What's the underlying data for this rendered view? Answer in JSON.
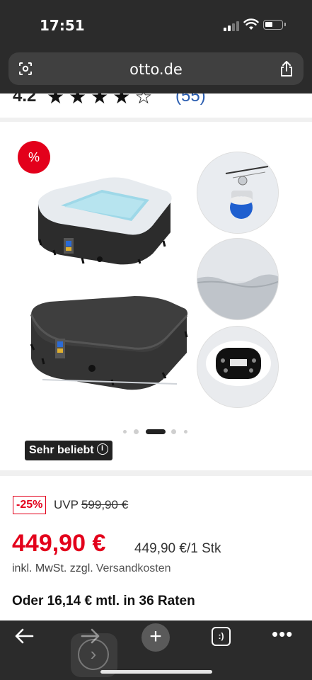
{
  "status": {
    "time": "17:51"
  },
  "browser": {
    "url": "otto.de"
  },
  "rating": {
    "score": "4.2",
    "stars": "★★★★☆",
    "count": "(55)"
  },
  "gallery": {
    "discount_badge": "%",
    "popular_label": "Sehr beliebt",
    "info_icon": "ⓘ",
    "pagination": {
      "count": 5,
      "active_index": 2
    }
  },
  "pricing": {
    "discount": "-25%",
    "uvp_label": "UVP",
    "uvp_price": "599,90 €",
    "price": "449,90 €",
    "unit_price": "449,90 €/1 Stk",
    "tax_text": "inkl. MwSt. zzgl.",
    "shipping_link": "Versandkosten",
    "installment": "Oder 16,14 € mtl. in 36 Raten"
  },
  "toolbar": {
    "plus": "+",
    "tabs": ":)",
    "more": "•••",
    "ghost": "›"
  },
  "colors": {
    "accent_red": "#e3001b",
    "chrome_dark": "#2b2b2b"
  }
}
